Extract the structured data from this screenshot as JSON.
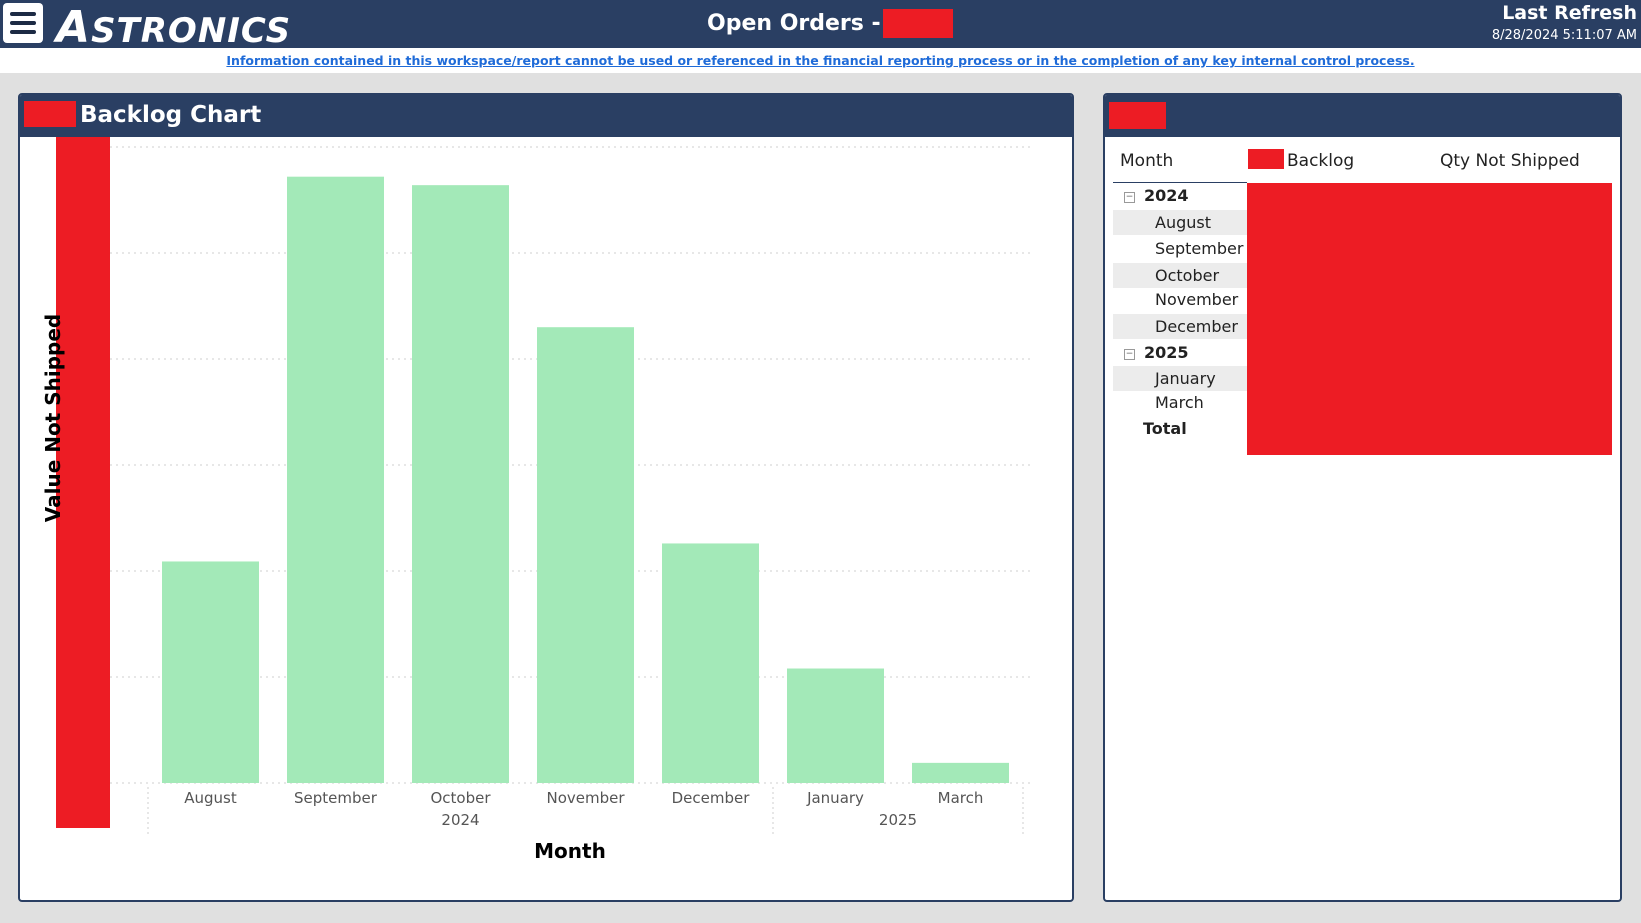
{
  "header": {
    "logo_initial": "A",
    "logo_rest": "STRONICS",
    "title": "Open Orders -",
    "refresh_title": "Last Refresh",
    "refresh_time": "8/28/2024 5:11:07 AM"
  },
  "notice": "Information contained in this workspace/report cannot be used or referenced in the financial reporting process or in the completion of any key internal control process.",
  "backlog_panel": {
    "title": "Backlog Chart"
  },
  "chart_data": {
    "type": "bar",
    "categories": [
      "August",
      "September",
      "October",
      "November",
      "December",
      "January",
      "March"
    ],
    "year_groups": [
      {
        "year": "2024",
        "months": [
          "August",
          "September",
          "October",
          "November",
          "December"
        ]
      },
      {
        "year": "2025",
        "months": [
          "January",
          "March"
        ]
      }
    ],
    "values": [
      2.09,
      5.72,
      5.64,
      4.3,
      2.26,
      1.08,
      0.19
    ],
    "ylim": [
      0,
      6
    ],
    "xlabel": "Month",
    "ylabel": "Value Not Shipped",
    "grid": true,
    "bar_color": "#a3e9b8"
  },
  "table_panel": {
    "columns": [
      "Month",
      "Backlog",
      "Qty Not Shipped"
    ],
    "rows": [
      {
        "label": "2024",
        "type": "year"
      },
      {
        "label": "August",
        "type": "month"
      },
      {
        "label": "September",
        "type": "month"
      },
      {
        "label": "October",
        "type": "month"
      },
      {
        "label": "November",
        "type": "month"
      },
      {
        "label": "December",
        "type": "month"
      },
      {
        "label": "2025",
        "type": "year"
      },
      {
        "label": "January",
        "type": "month"
      },
      {
        "label": "March",
        "type": "month"
      },
      {
        "label": "Total",
        "type": "total"
      }
    ]
  },
  "colors": {
    "header_bg": "#2a3f63",
    "redaction": "#ed1c24",
    "link": "#1f6bd8"
  }
}
